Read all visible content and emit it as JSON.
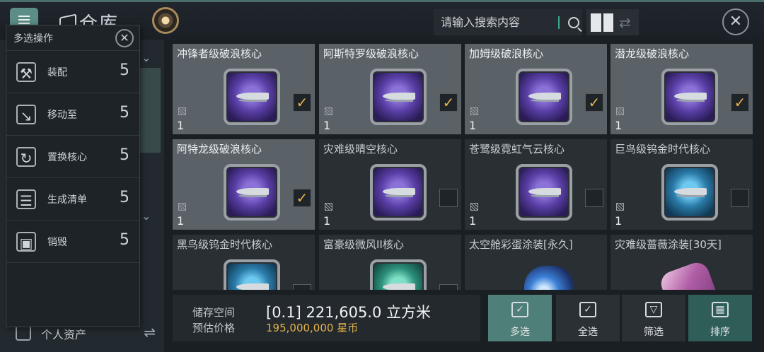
{
  "header": {
    "title": "仓库",
    "search_placeholder": "请输入搜索内容"
  },
  "multi_select": {
    "title": "多选操作",
    "actions": [
      {
        "label": "装配",
        "count": "5"
      },
      {
        "label": "移动至",
        "count": "5"
      },
      {
        "label": "置换核心",
        "count": "5"
      },
      {
        "label": "生成清单",
        "count": "5"
      },
      {
        "label": "销毁",
        "count": "5"
      }
    ]
  },
  "sidebar": {
    "bottom_label": "个人资产"
  },
  "items": [
    {
      "name": "冲锋者级破浪核心",
      "qty": "1",
      "selected": true,
      "style": "purple"
    },
    {
      "name": "阿斯特罗级破浪核心",
      "qty": "1",
      "selected": true,
      "style": "purple"
    },
    {
      "name": "加姆级破浪核心",
      "qty": "1",
      "selected": true,
      "style": "purple"
    },
    {
      "name": "潜龙级破浪核心",
      "qty": "1",
      "selected": true,
      "style": "purple"
    },
    {
      "name": "阿特龙级破浪核心",
      "qty": "1",
      "selected": true,
      "style": "purple"
    },
    {
      "name": "灾难级晴空核心",
      "qty": "1",
      "selected": false,
      "style": "purple"
    },
    {
      "name": "苍鹭级霓虹气云核心",
      "qty": "1",
      "selected": false,
      "style": "purple"
    },
    {
      "name": "巨鸟级钨金时代核心",
      "qty": "1",
      "selected": false,
      "style": "blue"
    },
    {
      "name": "黑鸟级钨金时代核心",
      "qty": "",
      "selected": false,
      "style": "blue"
    },
    {
      "name": "富豪级微风II核心",
      "qty": "",
      "selected": false,
      "style": "teal"
    },
    {
      "name": "太空舱彩蛋涂装[永久]",
      "qty": "",
      "selected": false,
      "style": "paint"
    },
    {
      "name": "灾难级蔷薇涂装[30天]",
      "qty": "",
      "selected": false,
      "style": "paint-pink"
    }
  ],
  "storage": {
    "space_label": "储存空间",
    "space_value": "[0.1] 221,605.0 立方米",
    "price_label": "预估价格",
    "price_value": "195,000,000 星币"
  },
  "buttons": {
    "multi": "多选",
    "select_all": "全选",
    "filter": "筛选",
    "sort": "排序"
  },
  "colors": {
    "accent": "#4e7f78",
    "check": "#e7b24c",
    "currency": "#e3b24a"
  }
}
